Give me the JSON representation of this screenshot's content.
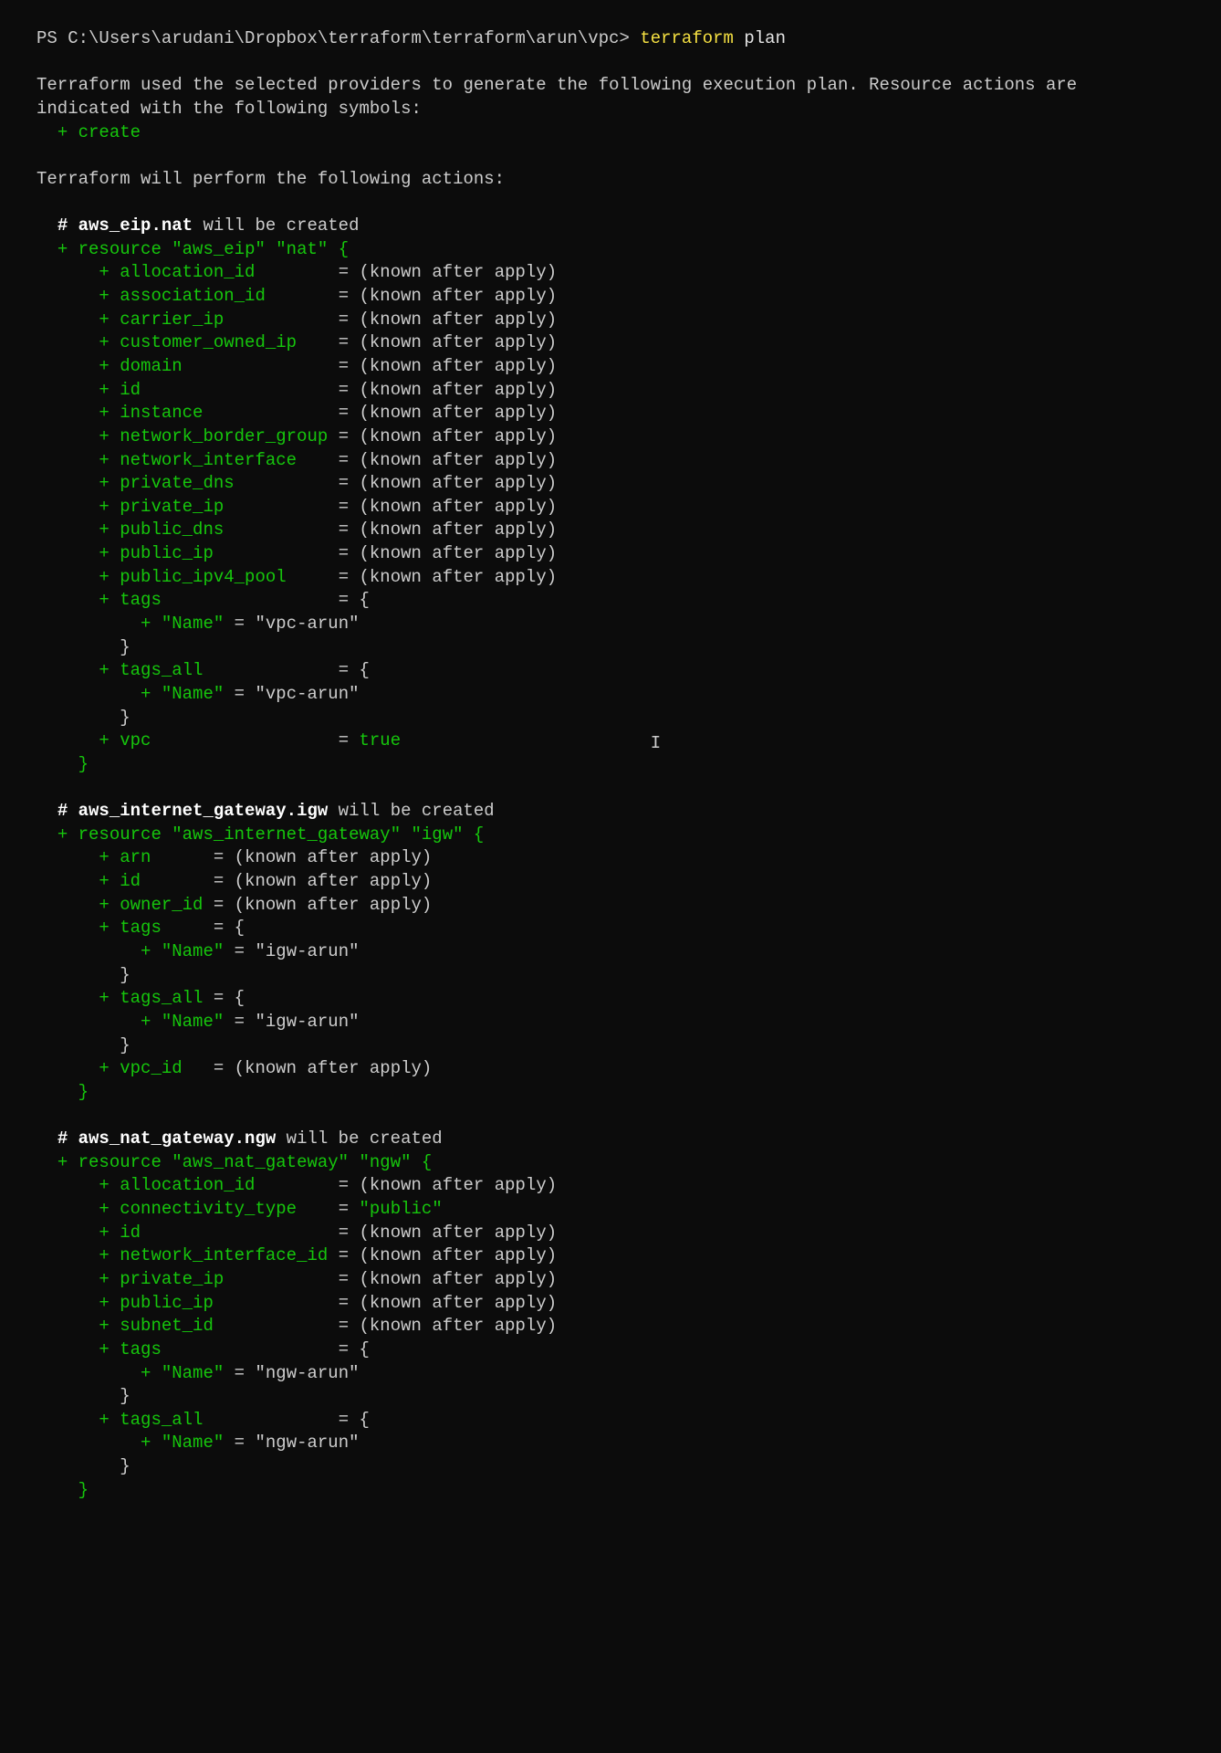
{
  "prompt_prefix": "PS ",
  "prompt_path": "C:\\Users\\arudani\\Dropbox\\terraform\\terraform\\arun\\vpc>",
  "cmd_main": "terraform",
  "cmd_arg": "plan",
  "intro1": "Terraform used the selected providers to generate the following execution plan. Resource actions are",
  "intro2": "indicated with the following symbols:",
  "sym_create": "create",
  "actions": "Terraform will perform the following actions:",
  "hash": "# ",
  "plus": "+",
  "eq": "=",
  "kaa": "(known after apply)",
  "open_br": "{",
  "close_br": "}",
  "true": "true",
  "public_str": "\"public\"",
  "willbe": " will be created",
  "res_word": "resource",
  "r1": {
    "name": "aws_eip.nat",
    "type": "\"aws_eip\"",
    "id": "\"nat\"",
    "attrs": {
      "a0": "allocation_id       ",
      "a1": "association_id      ",
      "a2": "carrier_ip          ",
      "a3": "customer_owned_ip   ",
      "a4": "domain              ",
      "a5": "id                  ",
      "a6": "instance            ",
      "a7": "network_border_group",
      "a8": "network_interface   ",
      "a9": "private_dns         ",
      "a10": "private_ip          ",
      "a11": "public_dns          ",
      "a12": "public_ip           ",
      "a13": "public_ipv4_pool    ",
      "tags": "tags                ",
      "tagsall": "tags_all            ",
      "vpc": "vpc                 "
    },
    "tag_key": "\"Name\"",
    "tag_val": "\"vpc-arun\""
  },
  "r2": {
    "name": "aws_internet_gateway.igw",
    "type": "\"aws_internet_gateway\"",
    "id": "\"igw\"",
    "attrs": {
      "a0": "arn     ",
      "a1": "id      ",
      "a2": "owner_id",
      "tags": "tags    ",
      "tagsall": "tags_all",
      "vpc": "vpc_id  "
    },
    "tag_key": "\"Name\"",
    "tag_val": "\"igw-arun\""
  },
  "r3": {
    "name": "aws_nat_gateway.ngw",
    "type": "\"aws_nat_gateway\"",
    "id": "\"ngw\"",
    "attrs": {
      "a0": "allocation_id       ",
      "a1": "connectivity_type   ",
      "a2": "id                  ",
      "a3": "network_interface_id",
      "a4": "private_ip          ",
      "a5": "public_ip           ",
      "a6": "subnet_id           ",
      "tags": "tags                ",
      "tagsall": "tags_all            "
    },
    "tag_key": "\"Name\"",
    "tag_val": "\"ngw-arun\""
  },
  "cursor": "I"
}
